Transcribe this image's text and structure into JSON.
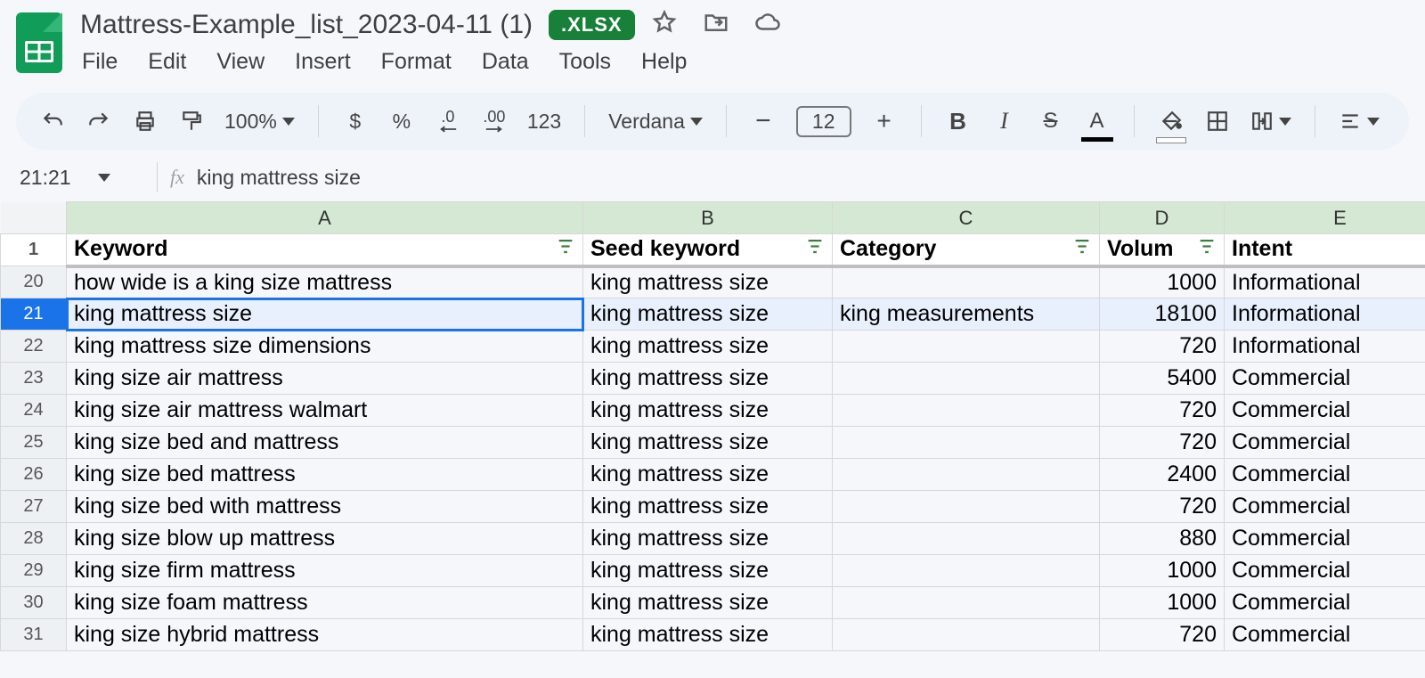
{
  "header": {
    "title": "Mattress-Example_list_2023-04-11 (1)",
    "badge": ".XLSX",
    "menus": [
      "File",
      "Edit",
      "View",
      "Insert",
      "Format",
      "Data",
      "Tools",
      "Help"
    ]
  },
  "toolbar": {
    "zoom": "100%",
    "currency": "$",
    "percent": "%",
    "dec_dec": ".0",
    "inc_dec": ".00",
    "num_123": "123",
    "font": "Verdana",
    "font_size": "12"
  },
  "fx": {
    "namebox": "21:21",
    "formula": "king mattress size"
  },
  "columns": [
    "A",
    "B",
    "C",
    "D",
    "E"
  ],
  "header_row_num": "1",
  "headers": {
    "A": "Keyword",
    "B": "Seed keyword",
    "C": "Category",
    "D": "Volum",
    "E": "Intent"
  },
  "selected_row": 21,
  "rows": [
    {
      "n": 20,
      "A": "how wide is a king size mattress",
      "B": "king mattress size",
      "C": "",
      "D": "1000",
      "E": "Informational"
    },
    {
      "n": 21,
      "A": "king mattress size",
      "B": "king mattress size",
      "C": "king measurements",
      "D": "18100",
      "E": "Informational"
    },
    {
      "n": 22,
      "A": "king mattress size dimensions",
      "B": "king mattress size",
      "C": "",
      "D": "720",
      "E": "Informational"
    },
    {
      "n": 23,
      "A": "king size air mattress",
      "B": "king mattress size",
      "C": "",
      "D": "5400",
      "E": "Commercial"
    },
    {
      "n": 24,
      "A": "king size air mattress walmart",
      "B": "king mattress size",
      "C": "",
      "D": "720",
      "E": "Commercial"
    },
    {
      "n": 25,
      "A": "king size bed and mattress",
      "B": "king mattress size",
      "C": "",
      "D": "720",
      "E": "Commercial"
    },
    {
      "n": 26,
      "A": "king size bed mattress",
      "B": "king mattress size",
      "C": "",
      "D": "2400",
      "E": "Commercial"
    },
    {
      "n": 27,
      "A": "king size bed with mattress",
      "B": "king mattress size",
      "C": "",
      "D": "720",
      "E": "Commercial"
    },
    {
      "n": 28,
      "A": "king size blow up mattress",
      "B": "king mattress size",
      "C": "",
      "D": "880",
      "E": "Commercial"
    },
    {
      "n": 29,
      "A": "king size firm mattress",
      "B": "king mattress size",
      "C": "",
      "D": "1000",
      "E": "Commercial"
    },
    {
      "n": 30,
      "A": "king size foam mattress",
      "B": "king mattress size",
      "C": "",
      "D": "1000",
      "E": "Commercial"
    },
    {
      "n": 31,
      "A": "king size hybrid mattress",
      "B": "king mattress size",
      "C": "",
      "D": "720",
      "E": "Commercial"
    }
  ]
}
